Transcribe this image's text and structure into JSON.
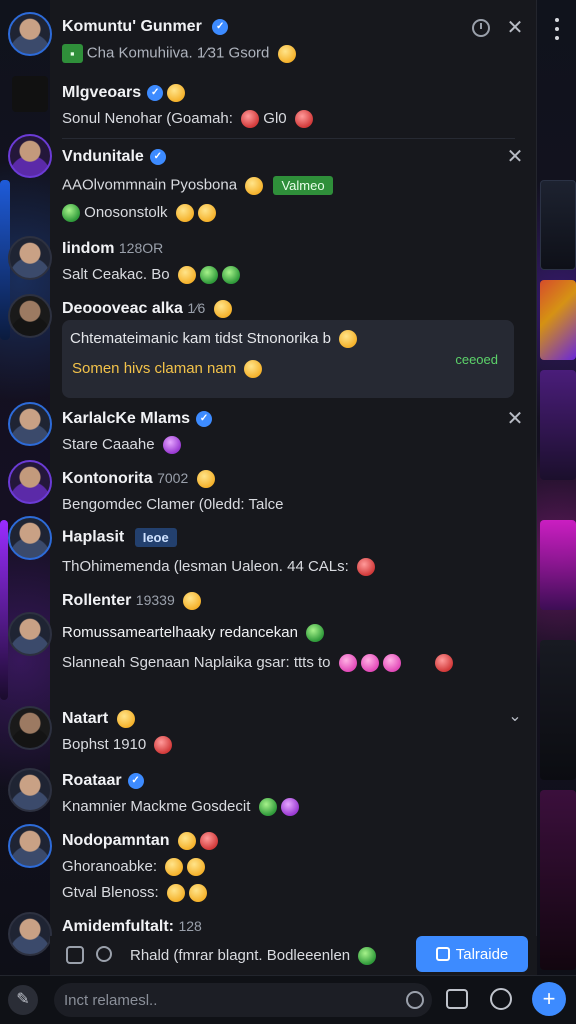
{
  "header": {
    "title": "Komuntu' Gunmer",
    "subtitle": "Cha Komuhiiva. 1⁄31 Gsord"
  },
  "messages": [
    {
      "name": "Mlgveoars",
      "text": "Sonul Nenohar (Goamah:",
      "extra": "Gl0"
    },
    {
      "name": "Vndunitale",
      "text": "AAOlvommnain Pyosbona",
      "tag": "Valmeo",
      "text2": "Onosonstolk"
    },
    {
      "name": "Iindom",
      "meta": "128OR",
      "text": "Salt Ceakac. Bo"
    },
    {
      "name": "Deoooveac alka",
      "meta": "1⁄6",
      "quote_line1": "Chtemateimanic kam tidst Stnonorika b",
      "quote_line2": "Somen hivs claman nam",
      "quote_meta": "ceeoed"
    },
    {
      "name": "KarlalcKe Mlams",
      "text": "Stare Caaahe"
    },
    {
      "name": "Kontonorita",
      "meta": "7002",
      "text": "Bengomdec Clamer (0ledd: Talce"
    },
    {
      "name": "Haplasit",
      "tag": "Ieoe",
      "text": "ThOhimemenda (lesman Ualeon. 44 CALs:"
    },
    {
      "name": "Rollenter",
      "meta": "19339",
      "text": ""
    },
    {
      "name": "Romussameartelhaaky redancekan",
      "text": "Slanneah Sgenaan Naplaika gsar: ttts to"
    },
    {
      "name": "Natart",
      "text": "Bophst 1910"
    },
    {
      "name": "Roataar",
      "text": "Knamnier Mackme Gosdecit"
    },
    {
      "name": "Nodopamntan",
      "text": "Ghoranoabke:",
      "text2": "Gtval Blenoss:"
    },
    {
      "name": "Amidemfultalt:",
      "meta": "128"
    }
  ],
  "composer": {
    "text": "Rhald (fmrar blagnt. Bodleeenlen",
    "reply_label": "Talraide"
  },
  "bottom_bar": {
    "placeholder": "Inct relamesl.."
  }
}
